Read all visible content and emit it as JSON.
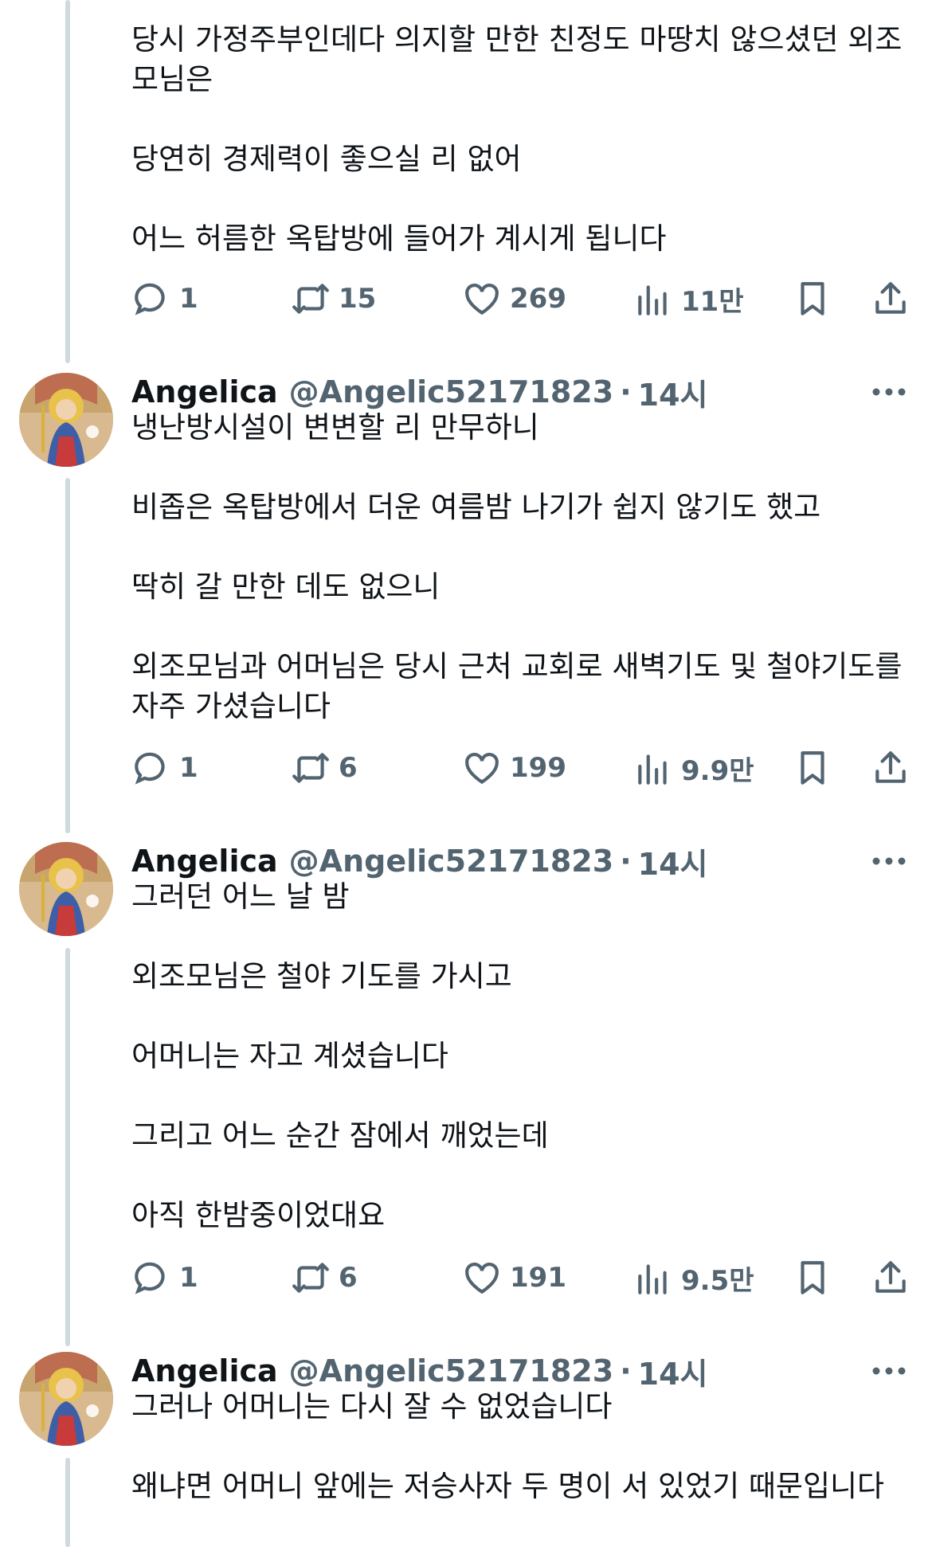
{
  "tweets": [
    {
      "paragraphs": [
        "당시 가정주부인데다 의지할 만한 친정도 마땅치 않으셨던 외조모님은",
        "당연히 경제력이 좋으실 리 없어",
        "어느 허름한 옥탑방에 들어가 계시게 됩니다"
      ],
      "reply_count": "1",
      "retweet_count": "15",
      "like_count": "269",
      "view_count": "11만"
    },
    {
      "display_name": "Angelica",
      "handle": "@Angelic52171823",
      "dot": "·",
      "time": "14시",
      "paragraphs": [
        "냉난방시설이 변변할 리 만무하니",
        "비좁은 옥탑방에서 더운 여름밤 나기가 쉽지 않기도 했고",
        "딱히 갈 만한 데도 없으니",
        "외조모님과 어머님은 당시 근처 교회로 새벽기도 및 철야기도를 자주 가셨습니다"
      ],
      "reply_count": "1",
      "retweet_count": "6",
      "like_count": "199",
      "view_count": "9.9만"
    },
    {
      "display_name": "Angelica",
      "handle": "@Angelic52171823",
      "dot": "·",
      "time": "14시",
      "paragraphs": [
        "그러던 어느 날 밤",
        "외조모님은 철야 기도를 가시고",
        "어머니는 자고 계셨습니다",
        "그리고 어느 순간 잠에서 깨었는데",
        "아직 한밤중이었대요"
      ],
      "reply_count": "1",
      "retweet_count": "6",
      "like_count": "191",
      "view_count": "9.5만"
    },
    {
      "display_name": "Angelica",
      "handle": "@Angelic52171823",
      "dot": "·",
      "time": "14시",
      "paragraphs": [
        "그러나 어머니는 다시 잘 수 없었습니다",
        "왜냐면 어머니 앞에는 저승사자 두 명이 서 있었기 때문입니다"
      ]
    }
  ],
  "icons": {
    "reply": "reply-icon",
    "retweet": "retweet-icon",
    "like": "heart-icon",
    "views": "views-icon",
    "bookmark": "bookmark-icon",
    "share": "share-icon",
    "more": "more-icon"
  },
  "colors": {
    "text": "#0f1419",
    "secondary": "#536471",
    "thread": "#cfd9de"
  }
}
